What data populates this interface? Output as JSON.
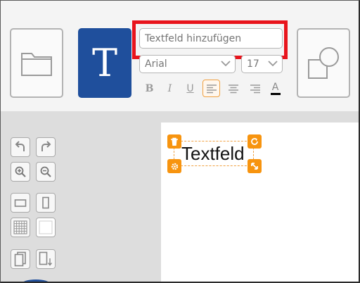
{
  "text_tool": {
    "input_placeholder": "Textfeld hinzufügen",
    "tool_glyph": "T"
  },
  "font_controls": {
    "font_family": "Arial",
    "font_size": "17"
  },
  "format_buttons": [
    {
      "name": "bold",
      "glyph": "B"
    },
    {
      "name": "italic",
      "glyph": "I"
    },
    {
      "name": "underline",
      "glyph": "U"
    },
    {
      "name": "align-left",
      "active": true
    },
    {
      "name": "align-center"
    },
    {
      "name": "align-right"
    },
    {
      "name": "text-color",
      "glyph": "A"
    }
  ],
  "canvas_object": {
    "text": "Textfeld"
  },
  "icons": {
    "open": "folder-icon",
    "shapes": "shapes-icon",
    "undo": "undo-icon",
    "redo": "redo-icon",
    "zoom_in": "zoom-in-icon",
    "zoom_out": "zoom-out-icon",
    "landscape": "landscape-page-icon",
    "portrait": "portrait-page-icon",
    "grid": "grid-icon",
    "blank": "blank-page-icon",
    "pages": "pages-icon",
    "page_add": "page-add-icon",
    "delete": "trash-icon",
    "rotate": "rotate-icon",
    "settings": "gear-icon",
    "resize": "resize-icon"
  },
  "colors": {
    "accent": "#f7940f",
    "brand_blue": "#1f4f9c",
    "highlight_red": "#e8141c"
  }
}
